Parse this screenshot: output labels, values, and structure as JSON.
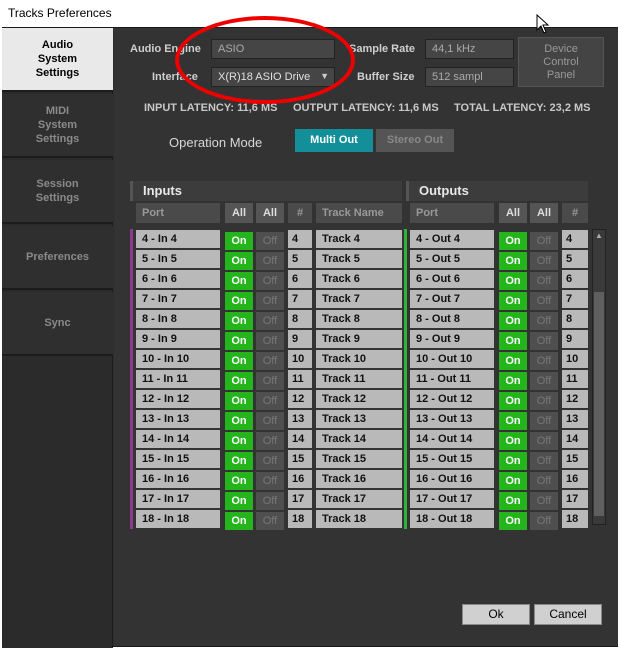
{
  "window": {
    "title": "Tracks Preferences"
  },
  "sidebar": {
    "tabs": [
      {
        "label": "Audio\nSystem\nSettings",
        "active": true
      },
      {
        "label": "MIDI\nSystem\nSettings",
        "active": false
      },
      {
        "label": "Session\nSettings",
        "active": false
      },
      {
        "label": "Preferences",
        "active": false
      },
      {
        "label": "Sync",
        "active": false
      }
    ]
  },
  "audio": {
    "engine_label": "Audio Engine",
    "engine_value": "ASIO",
    "interface_label": "Interface",
    "interface_value": "X(R)18 ASIO Drive",
    "sample_rate_label": "Sample Rate",
    "sample_rate_value": "44,1 kHz",
    "buffer_label": "Buffer Size",
    "buffer_value": "512 sampl",
    "device_panel_label": "Device\nControl\nPanel"
  },
  "latency": {
    "input": "INPUT LATENCY: 11,6 MS",
    "output": "OUTPUT LATENCY: 11,6 MS",
    "total": "TOTAL LATENCY: 23,2 MS"
  },
  "operation": {
    "label": "Operation Mode",
    "multi_out": "Multi Out",
    "stereo_out": "Stereo Out",
    "selected": "Multi Out"
  },
  "inputs": {
    "title": "Inputs",
    "headers": {
      "port": "Port",
      "all_on": "All",
      "all_off": "All",
      "num": "#",
      "name": "Track Name"
    },
    "rows": [
      {
        "port": "4 - In 4",
        "on": "On",
        "off": "Off",
        "num": "4",
        "name": "Track 4"
      },
      {
        "port": "5 - In 5",
        "on": "On",
        "off": "Off",
        "num": "5",
        "name": "Track 5"
      },
      {
        "port": "6 - In 6",
        "on": "On",
        "off": "Off",
        "num": "6",
        "name": "Track 6"
      },
      {
        "port": "7 - In 7",
        "on": "On",
        "off": "Off",
        "num": "7",
        "name": "Track 7"
      },
      {
        "port": "8 - In 8",
        "on": "On",
        "off": "Off",
        "num": "8",
        "name": "Track 8"
      },
      {
        "port": "9 - In 9",
        "on": "On",
        "off": "Off",
        "num": "9",
        "name": "Track 9"
      },
      {
        "port": "10 - In 10",
        "on": "On",
        "off": "Off",
        "num": "10",
        "name": "Track 10"
      },
      {
        "port": "11 - In 11",
        "on": "On",
        "off": "Off",
        "num": "11",
        "name": "Track 11"
      },
      {
        "port": "12 - In 12",
        "on": "On",
        "off": "Off",
        "num": "12",
        "name": "Track 12"
      },
      {
        "port": "13 - In 13",
        "on": "On",
        "off": "Off",
        "num": "13",
        "name": "Track 13"
      },
      {
        "port": "14 - In 14",
        "on": "On",
        "off": "Off",
        "num": "14",
        "name": "Track 14"
      },
      {
        "port": "15 - In 15",
        "on": "On",
        "off": "Off",
        "num": "15",
        "name": "Track 15"
      },
      {
        "port": "16 - In 16",
        "on": "On",
        "off": "Off",
        "num": "16",
        "name": "Track 16"
      },
      {
        "port": "17 - In 17",
        "on": "On",
        "off": "Off",
        "num": "17",
        "name": "Track 17"
      },
      {
        "port": "18 - In 18",
        "on": "On",
        "off": "Off",
        "num": "18",
        "name": "Track 18"
      }
    ]
  },
  "outputs": {
    "title": "Outputs",
    "headers": {
      "port": "Port",
      "all_on": "All",
      "all_off": "All",
      "num": "#"
    },
    "rows": [
      {
        "port": "4 - Out 4",
        "on": "On",
        "off": "Off",
        "num": "4"
      },
      {
        "port": "5 - Out 5",
        "on": "On",
        "off": "Off",
        "num": "5"
      },
      {
        "port": "6 - Out 6",
        "on": "On",
        "off": "Off",
        "num": "6"
      },
      {
        "port": "7 - Out 7",
        "on": "On",
        "off": "Off",
        "num": "7"
      },
      {
        "port": "8 - Out 8",
        "on": "On",
        "off": "Off",
        "num": "8"
      },
      {
        "port": "9 - Out 9",
        "on": "On",
        "off": "Off",
        "num": "9"
      },
      {
        "port": "10 - Out 10",
        "on": "On",
        "off": "Off",
        "num": "10"
      },
      {
        "port": "11 - Out 11",
        "on": "On",
        "off": "Off",
        "num": "11"
      },
      {
        "port": "12 - Out 12",
        "on": "On",
        "off": "Off",
        "num": "12"
      },
      {
        "port": "13 - Out 13",
        "on": "On",
        "off": "Off",
        "num": "13"
      },
      {
        "port": "14 - Out 14",
        "on": "On",
        "off": "Off",
        "num": "14"
      },
      {
        "port": "15 - Out 15",
        "on": "On",
        "off": "Off",
        "num": "15"
      },
      {
        "port": "16 - Out 16",
        "on": "On",
        "off": "Off",
        "num": "16"
      },
      {
        "port": "17 - Out 17",
        "on": "On",
        "off": "Off",
        "num": "17"
      },
      {
        "port": "18 - Out 18",
        "on": "On",
        "off": "Off",
        "num": "18"
      }
    ]
  },
  "buttons": {
    "ok": "Ok",
    "cancel": "Cancel"
  },
  "colors": {
    "accent_teal": "#138f9a",
    "on_green": "#24b41b",
    "inputs_strip": "#8b3a8f",
    "outputs_strip": "#2fb43a",
    "annotation_red": "#e00000"
  }
}
